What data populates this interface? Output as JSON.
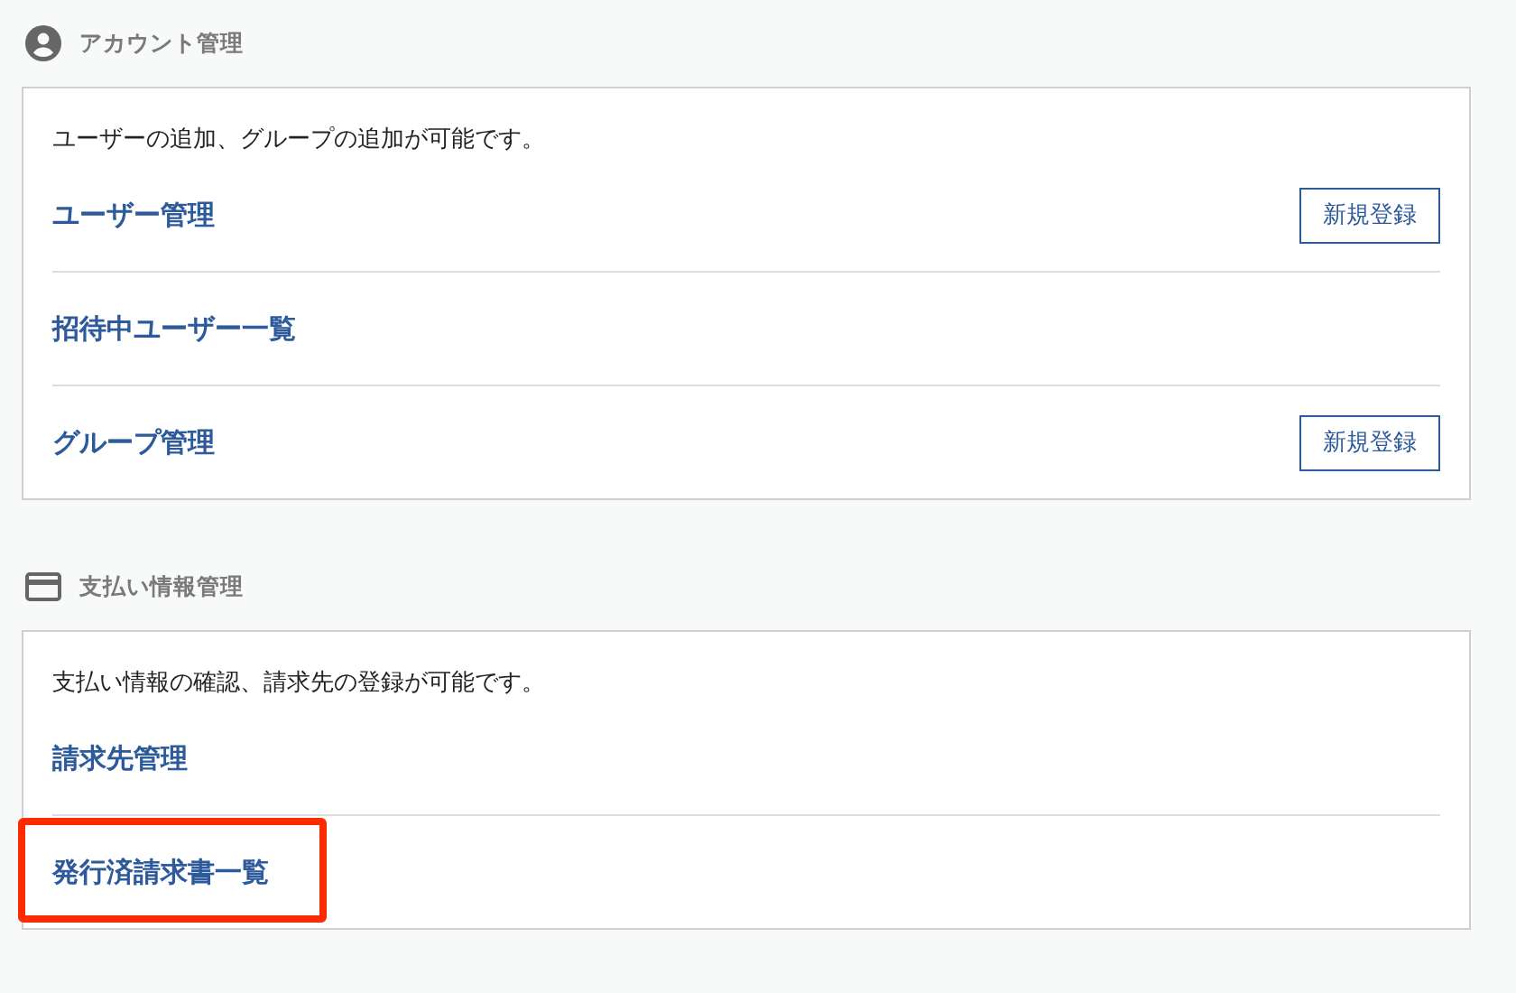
{
  "sections": [
    {
      "title": "アカウント管理",
      "description": "ユーザーの追加、グループの追加が可能です。",
      "items": [
        {
          "label": "ユーザー管理",
          "button": "新規登録",
          "highlighted": false
        },
        {
          "label": "招待中ユーザー一覧",
          "highlighted": false
        },
        {
          "label": "グループ管理",
          "button": "新規登録",
          "highlighted": false
        }
      ]
    },
    {
      "title": "支払い情報管理",
      "description": "支払い情報の確認、請求先の登録が可能です。",
      "items": [
        {
          "label": "請求先管理",
          "highlighted": false
        },
        {
          "label": "発行済請求書一覧",
          "highlighted": true
        }
      ]
    }
  ]
}
